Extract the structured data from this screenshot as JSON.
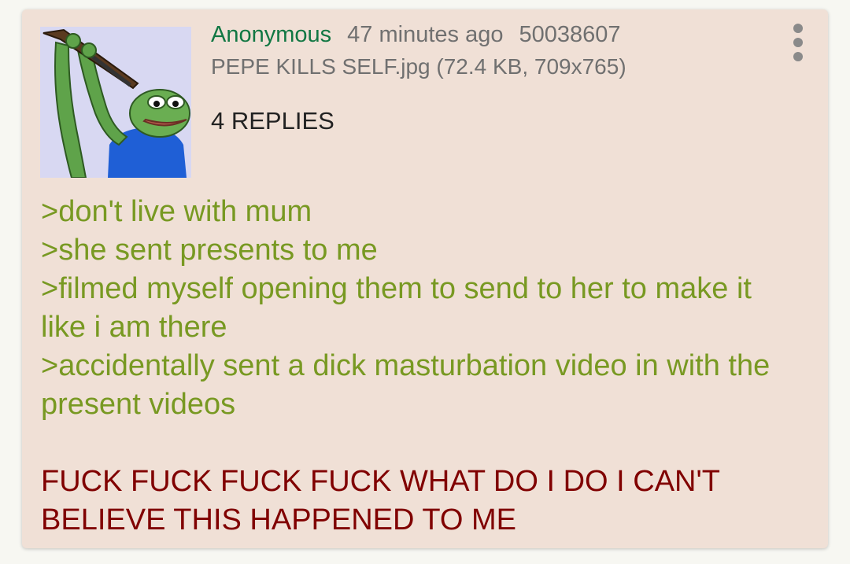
{
  "post": {
    "name": "Anonymous",
    "time": "47 minutes ago",
    "post_number": "50038607",
    "file": "PEPE KILLS SELF.jpg (72.4 KB, 709x765)",
    "replies": "4 REPLIES",
    "thumbnail_icon": "pepe-frog-with-rifle-image"
  },
  "body": {
    "greentext": [
      ">don't live with mum",
      ">she sent presents to me",
      ">filmed myself opening them to send to her to make it like i am there",
      ">accidentally sent a dick masturbation video in with the present videos"
    ],
    "red_text": "FUCK FUCK FUCK FUCK WHAT DO I DO I CAN'T BELIEVE THIS HAPPENED TO ME"
  },
  "colors": {
    "card_background": "#f0e0d6",
    "name": "#117743",
    "meta": "#707070",
    "greentext": "#789922",
    "red_text": "#800000"
  },
  "menu_icon": "more-vertical-icon"
}
